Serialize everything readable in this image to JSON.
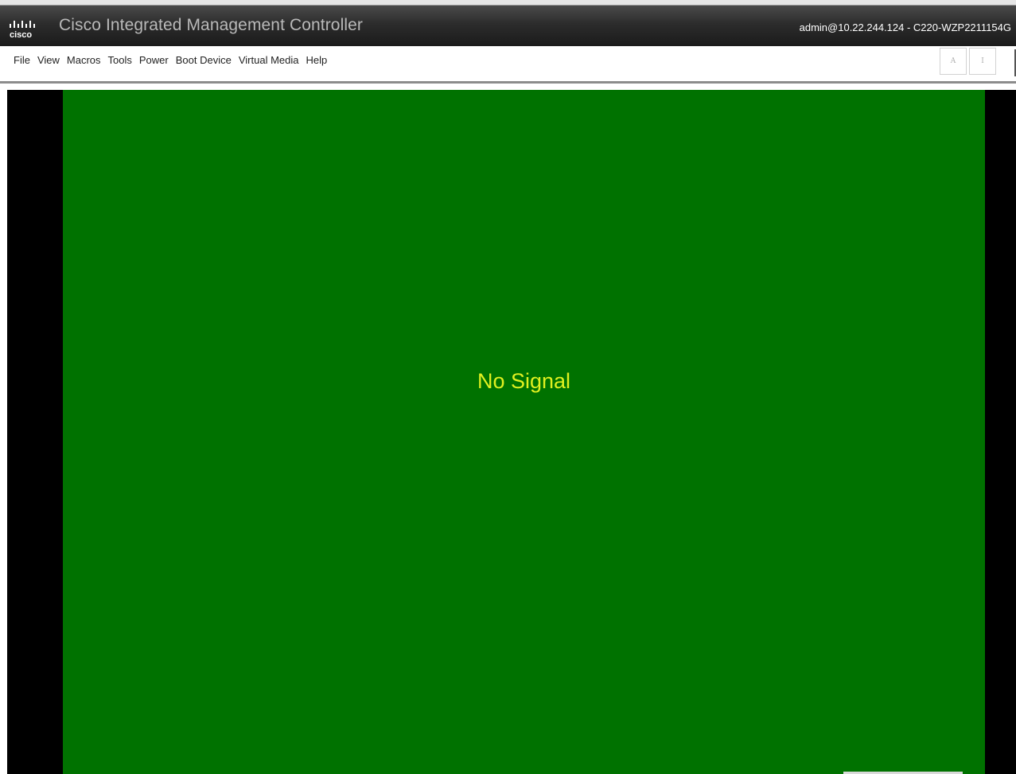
{
  "titlebar": {
    "brand": "cisco",
    "app_title": "Cisco Integrated Management Controller",
    "session": "admin@10.22.244.124 - C220-WZP2211154G",
    "logo_icon": "cisco-logo-icon"
  },
  "menu": {
    "items": [
      {
        "label": "File"
      },
      {
        "label": "View"
      },
      {
        "label": "Macros"
      },
      {
        "label": "Tools"
      },
      {
        "label": "Power"
      },
      {
        "label": "Boot Device"
      },
      {
        "label": "Virtual Media"
      },
      {
        "label": "Help"
      }
    ],
    "keyboard_indicators": [
      {
        "label": "A"
      },
      {
        "label": "I"
      }
    ]
  },
  "viewer": {
    "status_text": "No Signal",
    "screen_color": "#007200",
    "text_color": "#e0f020",
    "frame_color": "#000000"
  },
  "colors": {
    "titlebar": "#1b1b1b",
    "title_text": "#b9b9b9"
  }
}
